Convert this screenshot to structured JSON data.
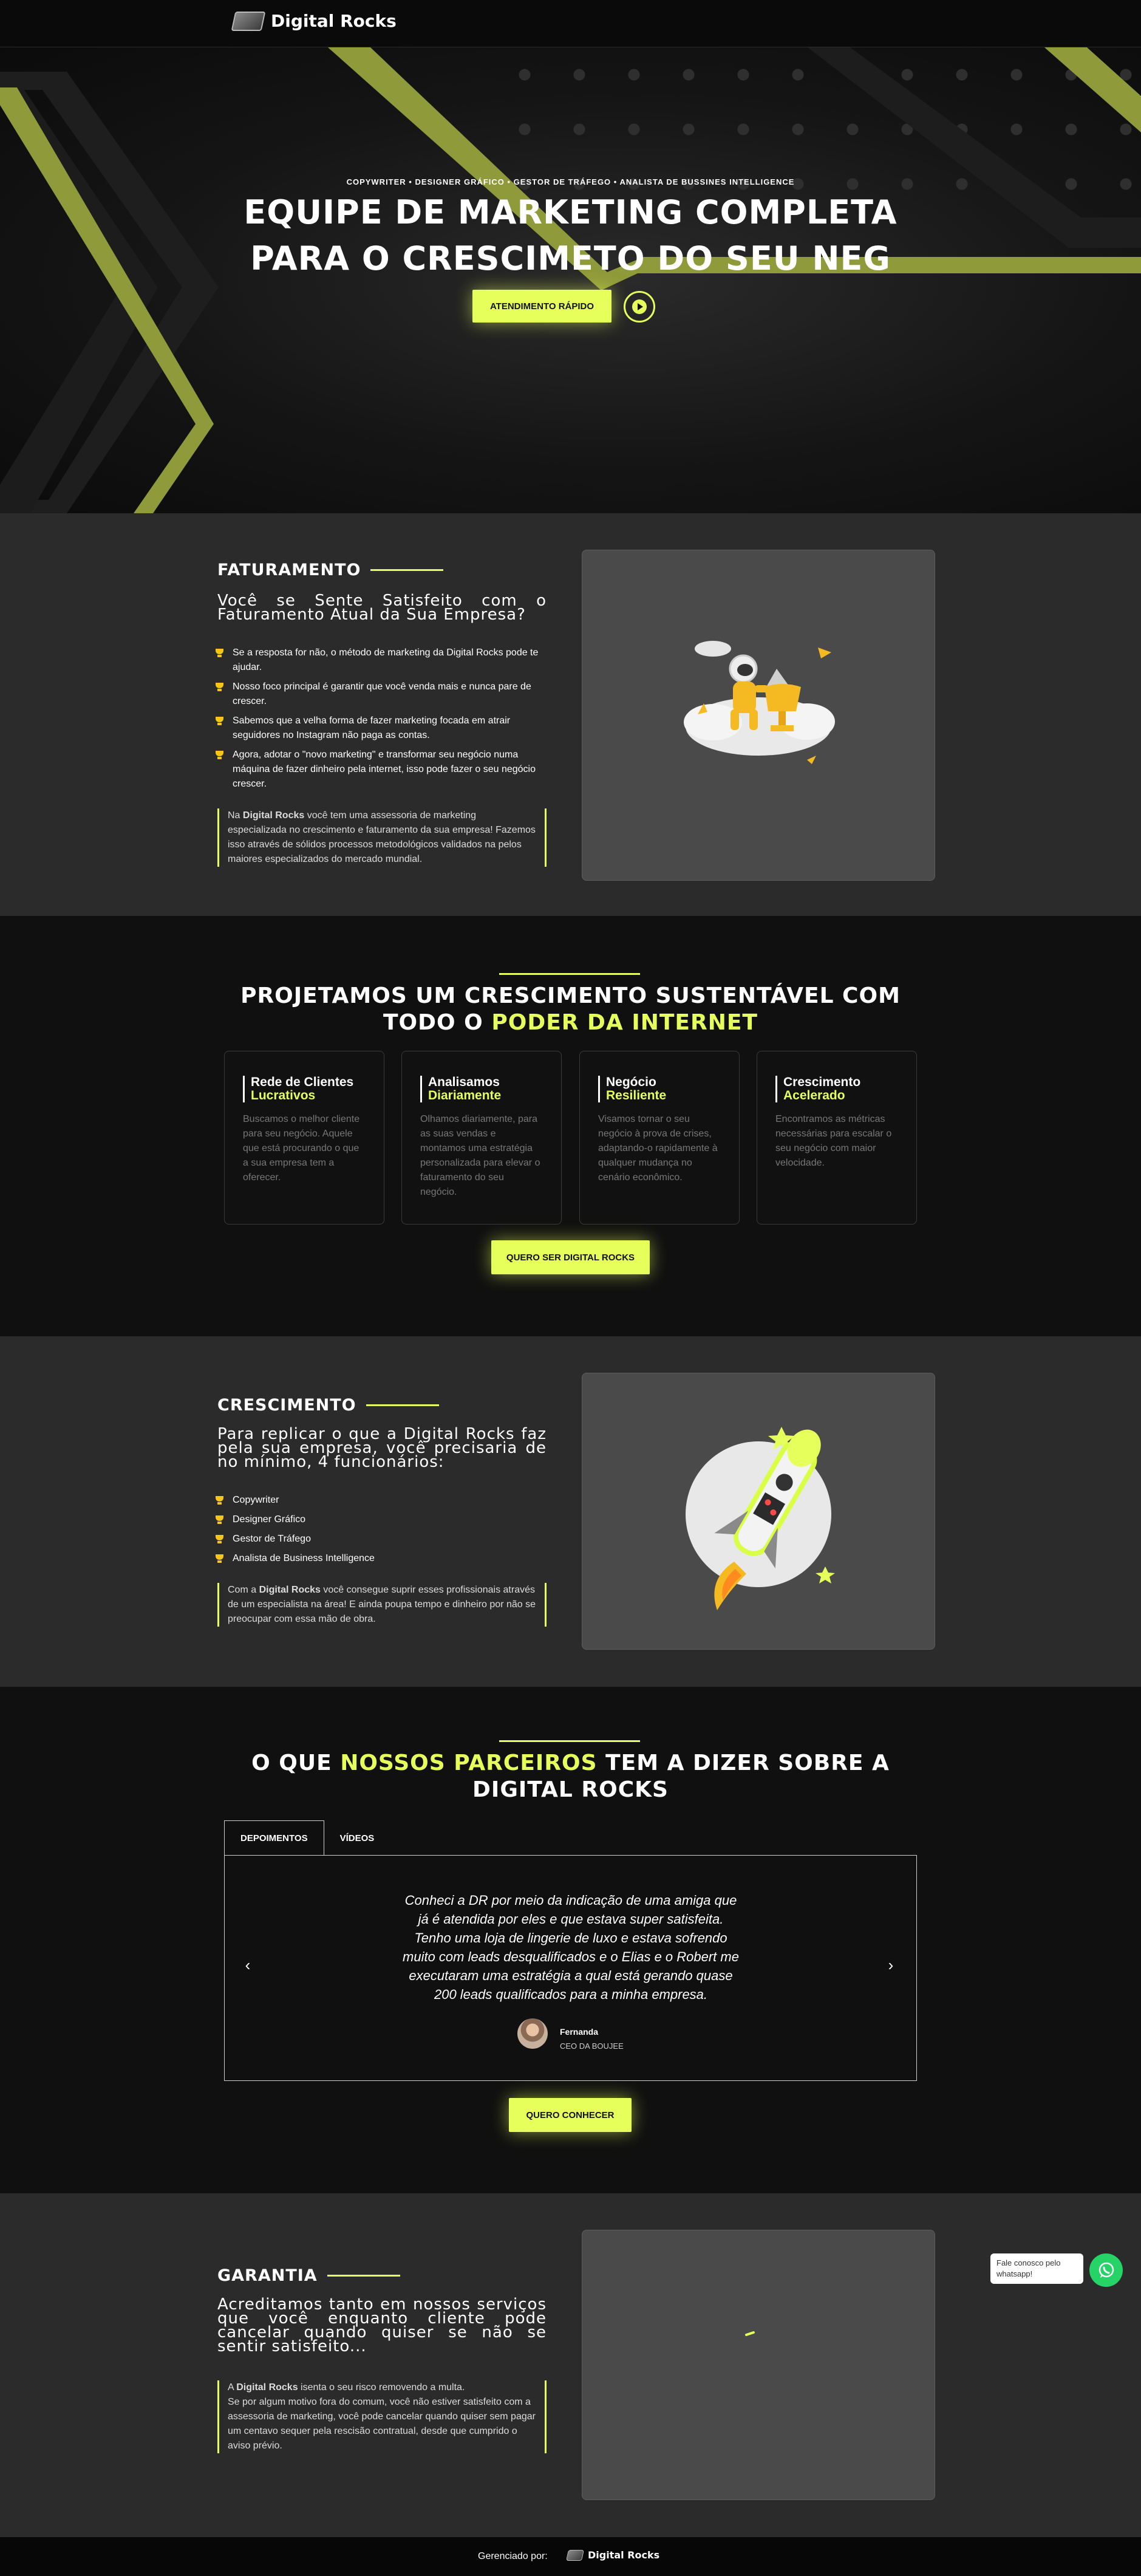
{
  "header": {
    "brand": "Digital Rocks"
  },
  "hero": {
    "tagline": "COPYWRITER • DESIGNER GRÁFICO • GESTOR DE TRÁFEGO • ANALISTA DE BUSSINES INTELLIGENCE",
    "title_line1": "EQUIPE DE MARKETING COMPLETA",
    "title_line2": "PARA O CRESCIMETO DO SEU NEG",
    "cta_label": "ATENDIMENTO RÁPIDO"
  },
  "faturamento": {
    "heading": "FATURAMENTO",
    "subtitle": "Você se Sente Satisfeito com o Faturamento Atual da Sua Empresa?",
    "bullets": [
      "Se a resposta for não, o método de marketing da Digital Rocks pode te ajudar.",
      "Nosso foco principal é garantir que você venda mais e nunca pare de crescer.",
      "Sabemos que a velha forma de fazer marketing focada em atrair seguidores no Instagram não paga as contas.",
      "Agora, adotar o \"novo marketing\" e transformar seu negócio numa máquina de fazer dinheiro pela internet, isso pode fazer o seu negócio crescer."
    ],
    "note_prefix": "Na ",
    "note_brand": "Digital Rocks",
    "note_rest": " você tem uma assessoria de marketing especializada no crescimento e faturamento da sua empresa! Fazemos isso através de sólidos processos metodológicos validados na pelos maiores especializados do mercado mundial."
  },
  "features": {
    "title_line1": "PROJETAMOS UM CRESCIMENTO SUSTENTÁVEL COM",
    "title_line2_a": "TODO O ",
    "title_line2_b": "PODER DA INTERNET",
    "cards": [
      {
        "title_a": "Rede de Clientes",
        "title_b": "Lucrativos",
        "text": "Buscamos o melhor cliente para seu negócio. Aquele que está procurando o que a sua empresa tem a oferecer."
      },
      {
        "title_a": "Analisamos",
        "title_b": "Diariamente",
        "text": "Olhamos diariamente, para as suas vendas e montamos uma estratégia personalizada para elevar o faturamento do seu negócio."
      },
      {
        "title_a": "Negócio",
        "title_b": "Resiliente",
        "text": "Visamos tornar o seu negócio à prova de crises, adaptando-o rapidamente à qualquer mudança no cenário econômico."
      },
      {
        "title_a": "Crescimento",
        "title_b": "Acelerado",
        "text": "Encontramos as métricas necessárias para escalar o seu negócio com maior velocidade."
      }
    ],
    "cta_label": "QUERO SER DIGITAL ROCKS"
  },
  "crescimento": {
    "heading": "CRESCIMENTO",
    "subtitle": "Para replicar o que a Digital Rocks faz pela sua empresa, você precisaria de no mínimo, 4 funcionários:",
    "bullets": [
      "Copywriter",
      "Designer Gráfico",
      "Gestor de Tráfego",
      "Analista de Business Intelligence"
    ],
    "note_prefix": "Com a ",
    "note_brand": "Digital Rocks",
    "note_rest": " você consegue suprir esses profissionais através de um especialista na área! E ainda poupa tempo e dinheiro por não se preocupar com essa mão de obra."
  },
  "testimonials": {
    "title_a": "O QUE ",
    "title_b": "NOSSOS PARCEIROS",
    "title_c": " TEM A DIZER SOBRE A",
    "title_line2": "DIGITAL ROCKS",
    "tabs": [
      "DEPOIMENTOS",
      "VÍDEOS"
    ],
    "quote": "Conheci a DR por meio da indicação de uma amiga que já é atendida por eles e que estava super satisfeita. Tenho uma loja de lingerie de luxo e estava sofrendo muito com leads desqualificados e o Elias e o Robert me executaram uma estratégia a qual está gerando quase 200 leads qualificados para a minha empresa.",
    "author_name": "Fernanda",
    "author_role": "CEO DA BOUJEE",
    "cta_label": "QUERO CONHECER"
  },
  "garantia": {
    "heading": "GARANTIA",
    "subtitle": "Acreditamos tanto em nossos serviços que você enquanto cliente pode cancelar quando quiser se não se sentir satisfeito...",
    "note_prefix": "A ",
    "note_brand": "Digital Rocks",
    "note_rest": " isenta o seu risco removendo a multa.",
    "note_line2": "Se por algum motivo fora do comum, você não estiver satisfeito com a assessoria de marketing, você pode cancelar quando quiser sem pagar um centavo sequer pela rescisão contratual, desde que cumprido o aviso prévio."
  },
  "footer": {
    "managed_by": "Gerenciado por:",
    "brand": "Digital Rocks"
  },
  "whatsapp": {
    "bubble_line1": "Fale conosco pelo",
    "bubble_line2": "whatsapp!"
  },
  "colors": {
    "accent": "#e6ff5a",
    "bg_dark": "#101010",
    "bg_gray": "#2b2b2b",
    "olive": "#8f9a3a",
    "whatsapp": "#25d366"
  },
  "icons": [
    "logo-mark",
    "play-icon",
    "trophy-icon",
    "chevron-left-icon",
    "chevron-right-icon",
    "whatsapp-icon"
  ]
}
